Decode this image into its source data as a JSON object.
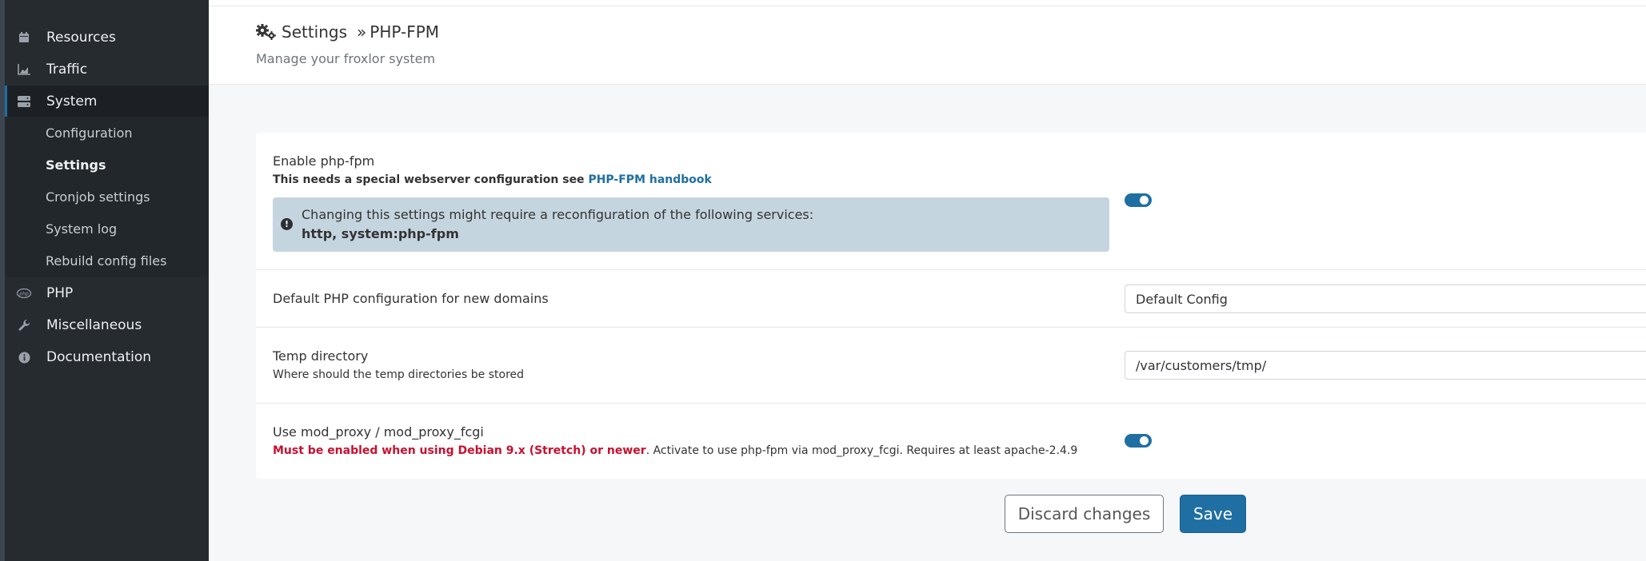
{
  "sidebar": {
    "items": [
      {
        "label": "Resources",
        "icon": "calendar-icon"
      },
      {
        "label": "Traffic",
        "icon": "chart-area-icon"
      },
      {
        "label": "System",
        "icon": "server-icon"
      },
      {
        "label": "PHP",
        "icon": "php-icon"
      },
      {
        "label": "Miscellaneous",
        "icon": "wrench-icon"
      },
      {
        "label": "Documentation",
        "icon": "info-icon"
      }
    ],
    "subitems": [
      {
        "label": "Configuration"
      },
      {
        "label": "Settings"
      },
      {
        "label": "Cronjob settings"
      },
      {
        "label": "System log"
      },
      {
        "label": "Rebuild config files"
      }
    ]
  },
  "header": {
    "title": "Settings",
    "separator": "»",
    "section": "PHP-FPM",
    "subtitle": "Manage your froxlor system"
  },
  "settings": {
    "enable_fpm": {
      "title": "Enable php-fpm",
      "desc_prefix": "This needs a special webserver configuration see",
      "desc_link": "PHP-FPM handbook",
      "alert_icon": "!",
      "alert_text": "Changing this settings might require a reconfiguration of the following services:",
      "alert_services": "http, system:php-fpm",
      "enabled": true
    },
    "default_config": {
      "title": "Default PHP configuration for new domains",
      "value": "Default Config"
    },
    "temp_dir": {
      "title": "Temp directory",
      "desc": "Where should the temp directories be stored",
      "value": "/var/customers/tmp/"
    },
    "mod_proxy": {
      "title": "Use mod_proxy / mod_proxy_fcgi",
      "desc_warning": "Must be enabled when using Debian 9.x (Stretch) or newer",
      "desc_rest": ". Activate to use php-fpm via mod_proxy_fcgi. Requires at least apache-2.4.9",
      "enabled": true
    }
  },
  "buttons": {
    "discard": "Discard changes",
    "save": "Save"
  },
  "colors": {
    "accent": "#1f6fa3",
    "sidebar_bg": "#262b30",
    "alert_bg": "#c5d5e0",
    "warning": "#c8102e"
  }
}
